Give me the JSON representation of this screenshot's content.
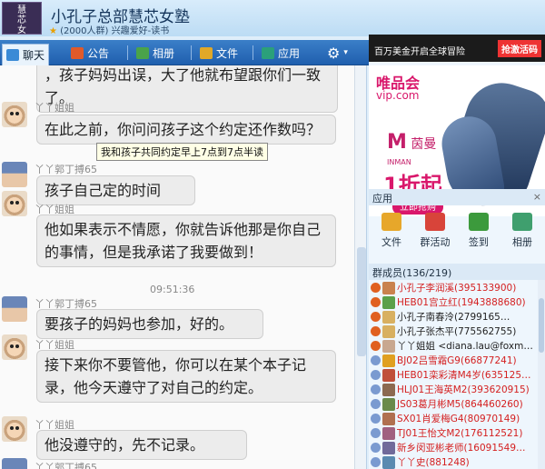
{
  "header": {
    "logo_lines": [
      "慧",
      "芯",
      "女",
      "塾"
    ],
    "title": "小孔子总部慧芯女塾",
    "subtitle": "(2000人群) 兴趣爱好-读书"
  },
  "toolbar": {
    "tabs": [
      {
        "label": "聊天",
        "color": "#3a8ad6"
      },
      {
        "label": "公告",
        "color": "#e05a2a"
      },
      {
        "label": "相册",
        "color": "#4aa34a"
      },
      {
        "label": "文件",
        "color": "#e0a828"
      },
      {
        "label": "应用",
        "color": "#2ba07a"
      }
    ],
    "settings_icon": "gear-icon"
  },
  "chat": {
    "messages": [
      {
        "sender": "",
        "text": "，孩子妈妈出误，大了他就布望跟你们一致了。"
      },
      {
        "sender": "丫丫姐姐",
        "text": "在此之前，你问问孩子这个约定还作数吗？"
      },
      {
        "sender": "丫丫郭丁搏65",
        "text": "孩子自己定的时间"
      },
      {
        "sender": "丫丫姐姐",
        "text": "他如果表示不情愿，你就告诉他那是你自己的事情，但是我承诺了我要做到！"
      },
      {
        "sender": "丫丫郭丁搏65",
        "text": "要孩子的妈妈也参加，好的。"
      },
      {
        "sender": "丫丫姐姐",
        "text": "接下来你不要管他，你可以在某个本子记录，他今天遵守了对自己的约定。"
      },
      {
        "sender": "丫丫姐姐",
        "text": "他没遵守的，先不记录。"
      },
      {
        "sender": "丫丫郭丁搏65",
        "text": ""
      }
    ],
    "tooltip": "我和孩子共同约定早上7点到7点半读",
    "timestamp": "09:51:36"
  },
  "ads": {
    "top_left": "百万美金开启全球冒险",
    "top_right": "抢激活码",
    "vip_line1": "唯品会",
    "vip_line2": "vip.com",
    "brand": "茵曼",
    "brand_en": "INMAN",
    "discount": "1折起",
    "buy_button": "立即抢购"
  },
  "apps": {
    "header": "应用",
    "items": [
      {
        "label": "文件",
        "color": "#e7a72a"
      },
      {
        "label": "群活动",
        "color": "#d8443a"
      },
      {
        "label": "签到",
        "color": "#3c9a3c"
      },
      {
        "label": "相册",
        "color": "#3f9f6e"
      }
    ]
  },
  "members": {
    "header": "群成员(136/219)",
    "list": [
      {
        "name": "小孔子李润溪(395133900)",
        "color": "#d42020"
      },
      {
        "name": "HEB01宫立红(1943888680)",
        "color": "#d42020"
      },
      {
        "name": "小孔子南春泠(2799165…",
        "color": "#222222"
      },
      {
        "name": "小孔子张杰平(775562755)",
        "color": "#222222"
      },
      {
        "name": "丫丫姐姐 <diana.lau@foxm…",
        "color": "#222222"
      },
      {
        "name": "BJ02吕雪霜G9(66877241)",
        "color": "#d42020"
      },
      {
        "name": "HEB01栾彩清M4岁(635125…",
        "color": "#d42020"
      },
      {
        "name": "HLJ01王海英M2(393620915)",
        "color": "#d42020"
      },
      {
        "name": "JS03葛月彬M5(864460260)",
        "color": "#d42020"
      },
      {
        "name": "SX01肖爱梅G4(80970149)",
        "color": "#d42020"
      },
      {
        "name": "TJ01王怡文M2(176112521)",
        "color": "#d42020"
      },
      {
        "name": "新乡闵亚彬老师(16091549…",
        "color": "#d42020"
      },
      {
        "name": "丫丫史(881248)",
        "color": "#d42020"
      }
    ]
  }
}
